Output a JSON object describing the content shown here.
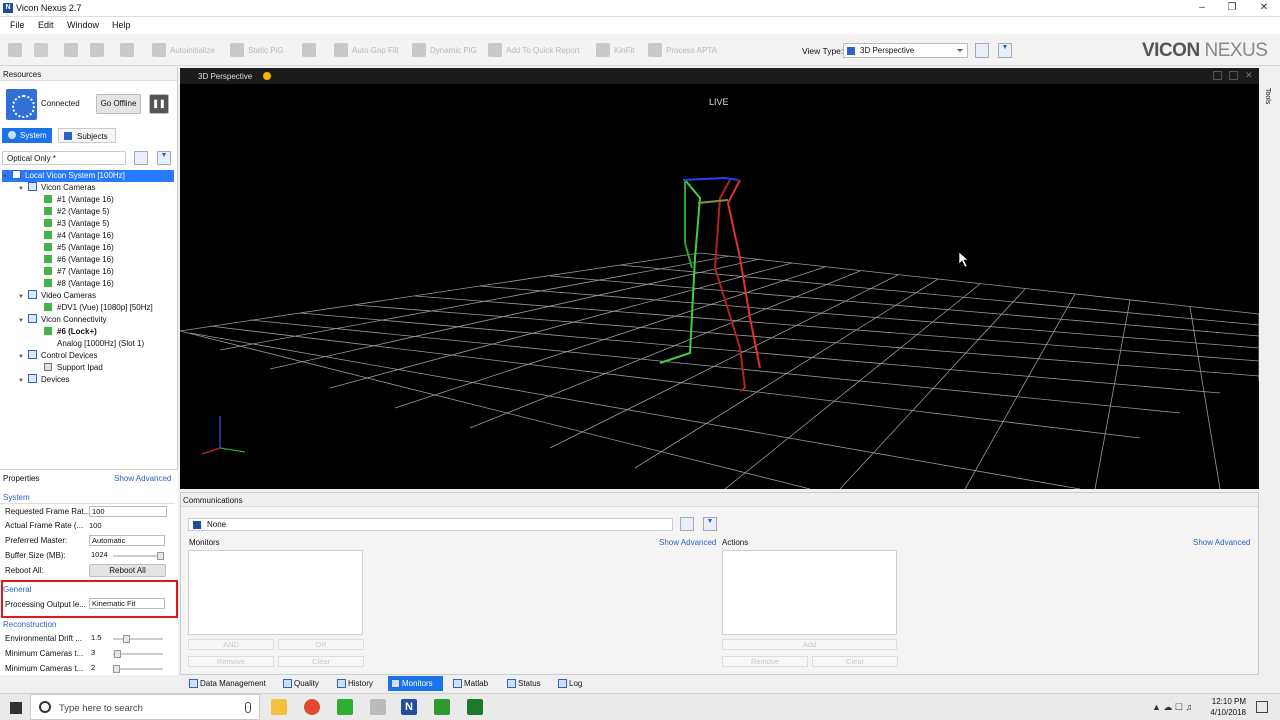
{
  "window": {
    "title": "Vicon Nexus 2.7",
    "app_icon": "N"
  },
  "menu": [
    "File",
    "Edit",
    "Window",
    "Help"
  ],
  "toolbar": {
    "actions": [
      "Autoinitialize",
      "Static PiG",
      "Auto Gap Fill",
      "Dynamic PiG",
      "Add To Quick Report",
      "KinFit",
      "Process APTA"
    ],
    "view_type_label": "View Type:",
    "view_type_value": "3D Perspective",
    "logo": "VICON",
    "logo_sub": "NEXUS"
  },
  "resources": {
    "title": "Resources",
    "status": "Connected",
    "go_offline": "Go Offline",
    "tabs": [
      "System",
      "Subjects"
    ],
    "filter_value": "Optical Only *",
    "tree": [
      {
        "label": "Local Vicon System [100Hz]"
      },
      {
        "label": "Vicon Cameras"
      },
      {
        "label": "#1 (Vantage 16)"
      },
      {
        "label": "#2 (Vantage 5)"
      },
      {
        "label": "#3 (Vantage 5)"
      },
      {
        "label": "#4 (Vantage 16)"
      },
      {
        "label": "#5 (Vantage 16)"
      },
      {
        "label": "#6 (Vantage 16)"
      },
      {
        "label": "#7 (Vantage 16)"
      },
      {
        "label": "#8 (Vantage 16)"
      },
      {
        "label": "Video Cameras"
      },
      {
        "label": "#DV1 (Vue) [1080p] [50Hz]"
      },
      {
        "label": "Vicon Connectivity"
      },
      {
        "label": "#6 (Lock+)"
      },
      {
        "label": "Analog [1000Hz] (Slot 1)"
      },
      {
        "label": "Control Devices"
      },
      {
        "label": "Support Ipad"
      },
      {
        "label": "Devices"
      }
    ]
  },
  "properties": {
    "title": "Properties",
    "show_advanced": "Show Advanced",
    "system_cat": "System",
    "requested_label": "Requested Frame Rat...",
    "requested_value": "100",
    "actual_label": "Actual Frame Rate (...",
    "actual_value": "100",
    "master_label": "Preferred Master:",
    "master_value": "Automatic",
    "buffer_label": "Buffer Size (MB):",
    "buffer_value": "1024",
    "reboot_label": "Reboot All:",
    "reboot_button": "Reboot All",
    "general_cat": "General",
    "processing_label": "Processing Output le...",
    "processing_value": "Kinematic Fit",
    "recon_cat": "Reconstruction",
    "drift_label": "Environmental Drift ...",
    "drift_value": "1.5",
    "mincam1_label": "Minimum Cameras t...",
    "mincam1_value": "3",
    "mincam2_label": "Minimum Cameras t...",
    "mincam2_value": "2"
  },
  "viewport": {
    "tab": "3D Perspective",
    "live": "LIVE",
    "side_label": "Tools"
  },
  "communications": {
    "title": "Communications",
    "select_value": "None",
    "monitors_label": "Monitors",
    "monitors_show_advanced": "Show Advanced",
    "actions_label": "Actions",
    "actions_show_advanced": "Show Advanced",
    "and": "AND",
    "or": "OR",
    "remove": "Remove",
    "clear": "Clear",
    "add": "Add"
  },
  "bottom_tabs": [
    "Data Management",
    "Quality",
    "History",
    "Monitors",
    "Matlab",
    "Status",
    "Log"
  ],
  "taskbar": {
    "search_placeholder": "Type here to search",
    "time": "12:10 PM",
    "date": "4/10/2018"
  }
}
